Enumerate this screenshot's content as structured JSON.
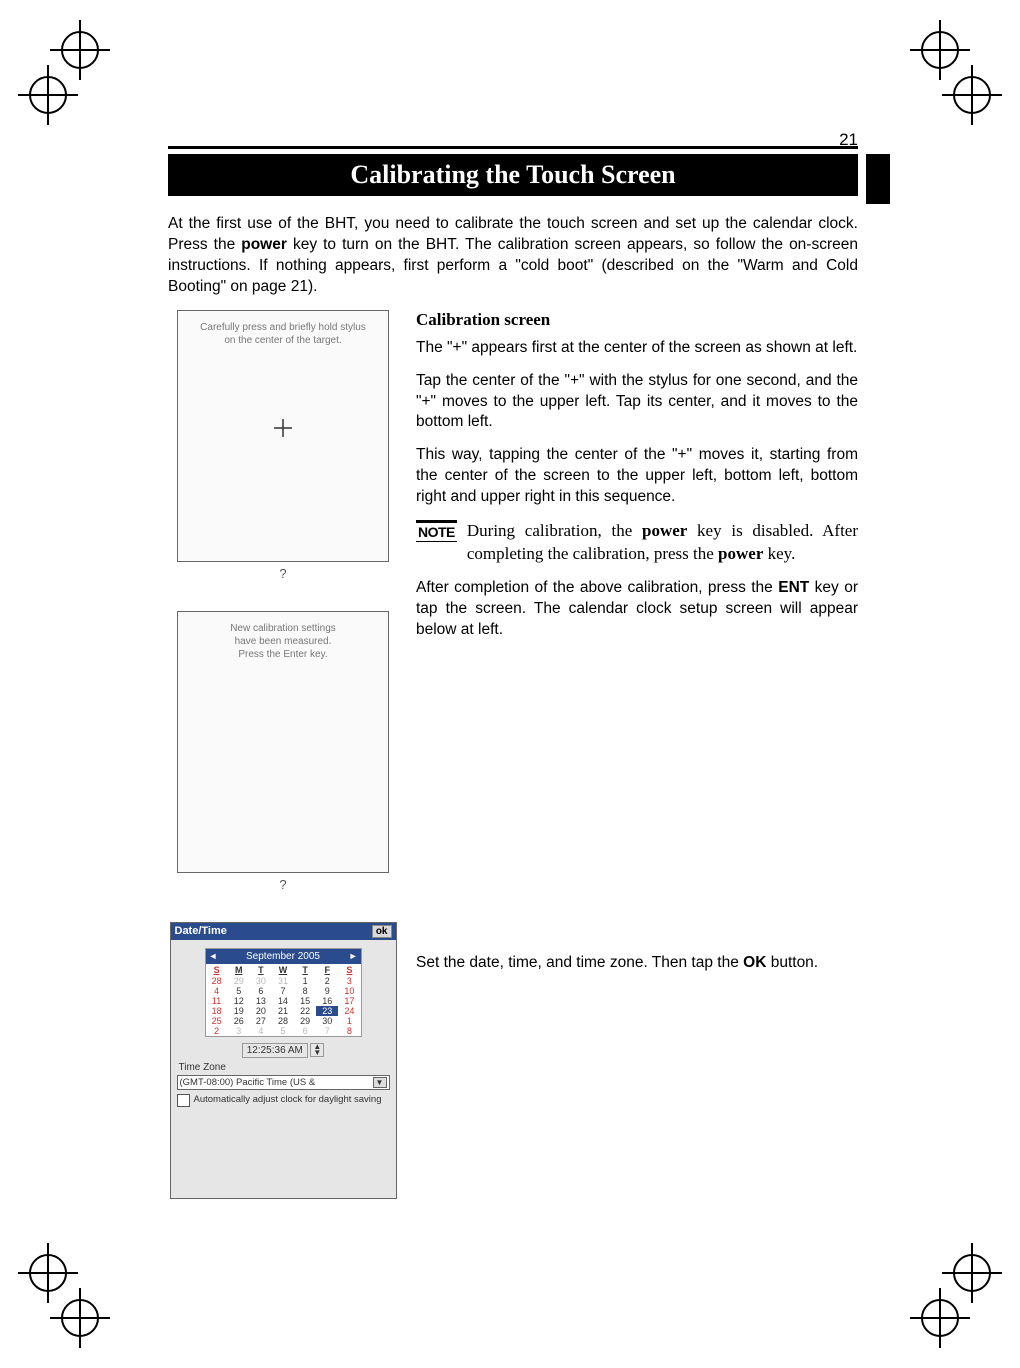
{
  "page_number": "21",
  "title": "Calibrating the Touch Screen",
  "intro": "At the first use of the BHT, you need to calibrate the touch screen and set up the calendar clock. Press the power key to turn on the BHT. The calibration screen appears, so follow the on-screen instructions. If nothing appears, first perform a \"cold boot\" (described on the \"Warm and Cold Booting\" on page 21).",
  "screenshots": {
    "shot1_line1": "Carefully press and briefly hold stylus",
    "shot1_line2": "on the center of the target.",
    "shot1_caption": "?",
    "shot2_line1": "New calibration settings",
    "shot2_line2": "have been measured.",
    "shot2_line3": "Press the Enter key.",
    "shot2_caption": "?"
  },
  "calibration": {
    "heading": "Calibration screen",
    "p1": "The \"+\" appears first at the center of the screen as shown at left.",
    "p2": "Tap the center of the \"+\" with the stylus for one second, and the \"+\" moves to the upper left. Tap its center, and it moves to the bottom left.",
    "p3": "This way, tapping the center of the \"+\" moves it, starting from the center of the screen to the upper left, bottom left, bottom right and upper right in this sequence.",
    "note_label": "NOTE",
    "note_text_1": "During calibration, the ",
    "note_bold_1": "power",
    "note_text_2": " key is disabled. After completing the calibration, press the ",
    "note_bold_2": "power",
    "note_text_3": " key.",
    "p4_a": "After completion of the above calibration, press the ",
    "p4_bold": "ENT",
    "p4_b": " key or tap the screen. The calendar clock setup screen will appear below at left."
  },
  "datetime": {
    "window_title": "Date/Time",
    "ok": "ok",
    "month_label": "September 2005",
    "dow": [
      "S",
      "M",
      "T",
      "W",
      "T",
      "F",
      "S"
    ],
    "cells": [
      {
        "t": "28",
        "c": "cal-dim"
      },
      {
        "t": "29",
        "c": "cal-dim"
      },
      {
        "t": "30",
        "c": "cal-dim"
      },
      {
        "t": "31",
        "c": "cal-dim"
      },
      {
        "t": "1",
        "c": ""
      },
      {
        "t": "2",
        "c": ""
      },
      {
        "t": "3",
        "c": ""
      },
      {
        "t": "4",
        "c": ""
      },
      {
        "t": "5",
        "c": ""
      },
      {
        "t": "6",
        "c": ""
      },
      {
        "t": "7",
        "c": ""
      },
      {
        "t": "8",
        "c": ""
      },
      {
        "t": "9",
        "c": ""
      },
      {
        "t": "10",
        "c": ""
      },
      {
        "t": "11",
        "c": ""
      },
      {
        "t": "12",
        "c": ""
      },
      {
        "t": "13",
        "c": ""
      },
      {
        "t": "14",
        "c": ""
      },
      {
        "t": "15",
        "c": ""
      },
      {
        "t": "16",
        "c": ""
      },
      {
        "t": "17",
        "c": ""
      },
      {
        "t": "18",
        "c": ""
      },
      {
        "t": "19",
        "c": ""
      },
      {
        "t": "20",
        "c": ""
      },
      {
        "t": "21",
        "c": ""
      },
      {
        "t": "22",
        "c": ""
      },
      {
        "t": "23",
        "c": "cal-sel"
      },
      {
        "t": "24",
        "c": ""
      },
      {
        "t": "25",
        "c": ""
      },
      {
        "t": "26",
        "c": ""
      },
      {
        "t": "27",
        "c": ""
      },
      {
        "t": "28",
        "c": ""
      },
      {
        "t": "29",
        "c": ""
      },
      {
        "t": "30",
        "c": ""
      },
      {
        "t": "1",
        "c": "cal-dim"
      },
      {
        "t": "2",
        "c": "cal-dim"
      },
      {
        "t": "3",
        "c": "cal-dim"
      },
      {
        "t": "4",
        "c": "cal-dim"
      },
      {
        "t": "5",
        "c": "cal-dim"
      },
      {
        "t": "6",
        "c": "cal-dim"
      },
      {
        "t": "7",
        "c": "cal-dim"
      },
      {
        "t": "8",
        "c": "cal-dim"
      }
    ],
    "time_value": "12:25:36 AM",
    "tz_label": "Time Zone",
    "tz_value": "(GMT-08:00) Pacific Time (US &",
    "chk_label": "Automatically adjust clock for daylight saving"
  },
  "bottom_para_a": "Set the date, time, and time zone. Then tap the ",
  "bottom_bold": "OK",
  "bottom_para_b": " button."
}
